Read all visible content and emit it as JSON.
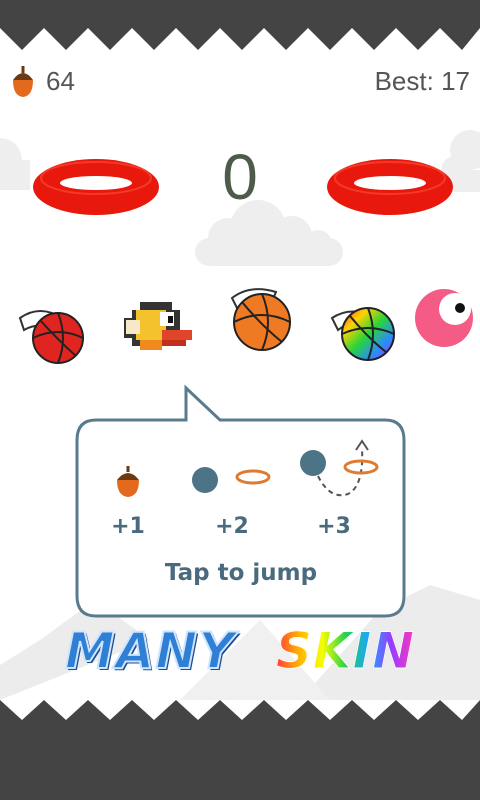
{
  "hud": {
    "acorn_count": "64",
    "best_label": "Best: 17"
  },
  "score": "0",
  "tutorial": {
    "points": [
      "+1",
      "+2",
      "+3"
    ],
    "caption": "Tap to jump"
  },
  "banner": {
    "word1": "MANY",
    "word2": "SKIN"
  },
  "skins": [
    "red-winged-basketball",
    "pixel-bird",
    "orange-winged-basketball",
    "rainbow-winged-basketball",
    "pink-blob"
  ],
  "colors": {
    "spikes": "#444444",
    "hoop": "#e8180c",
    "ball_dark": "#4d7386",
    "tutorial_border": "#5a7a8e",
    "small_hoop": "#e07a30"
  }
}
